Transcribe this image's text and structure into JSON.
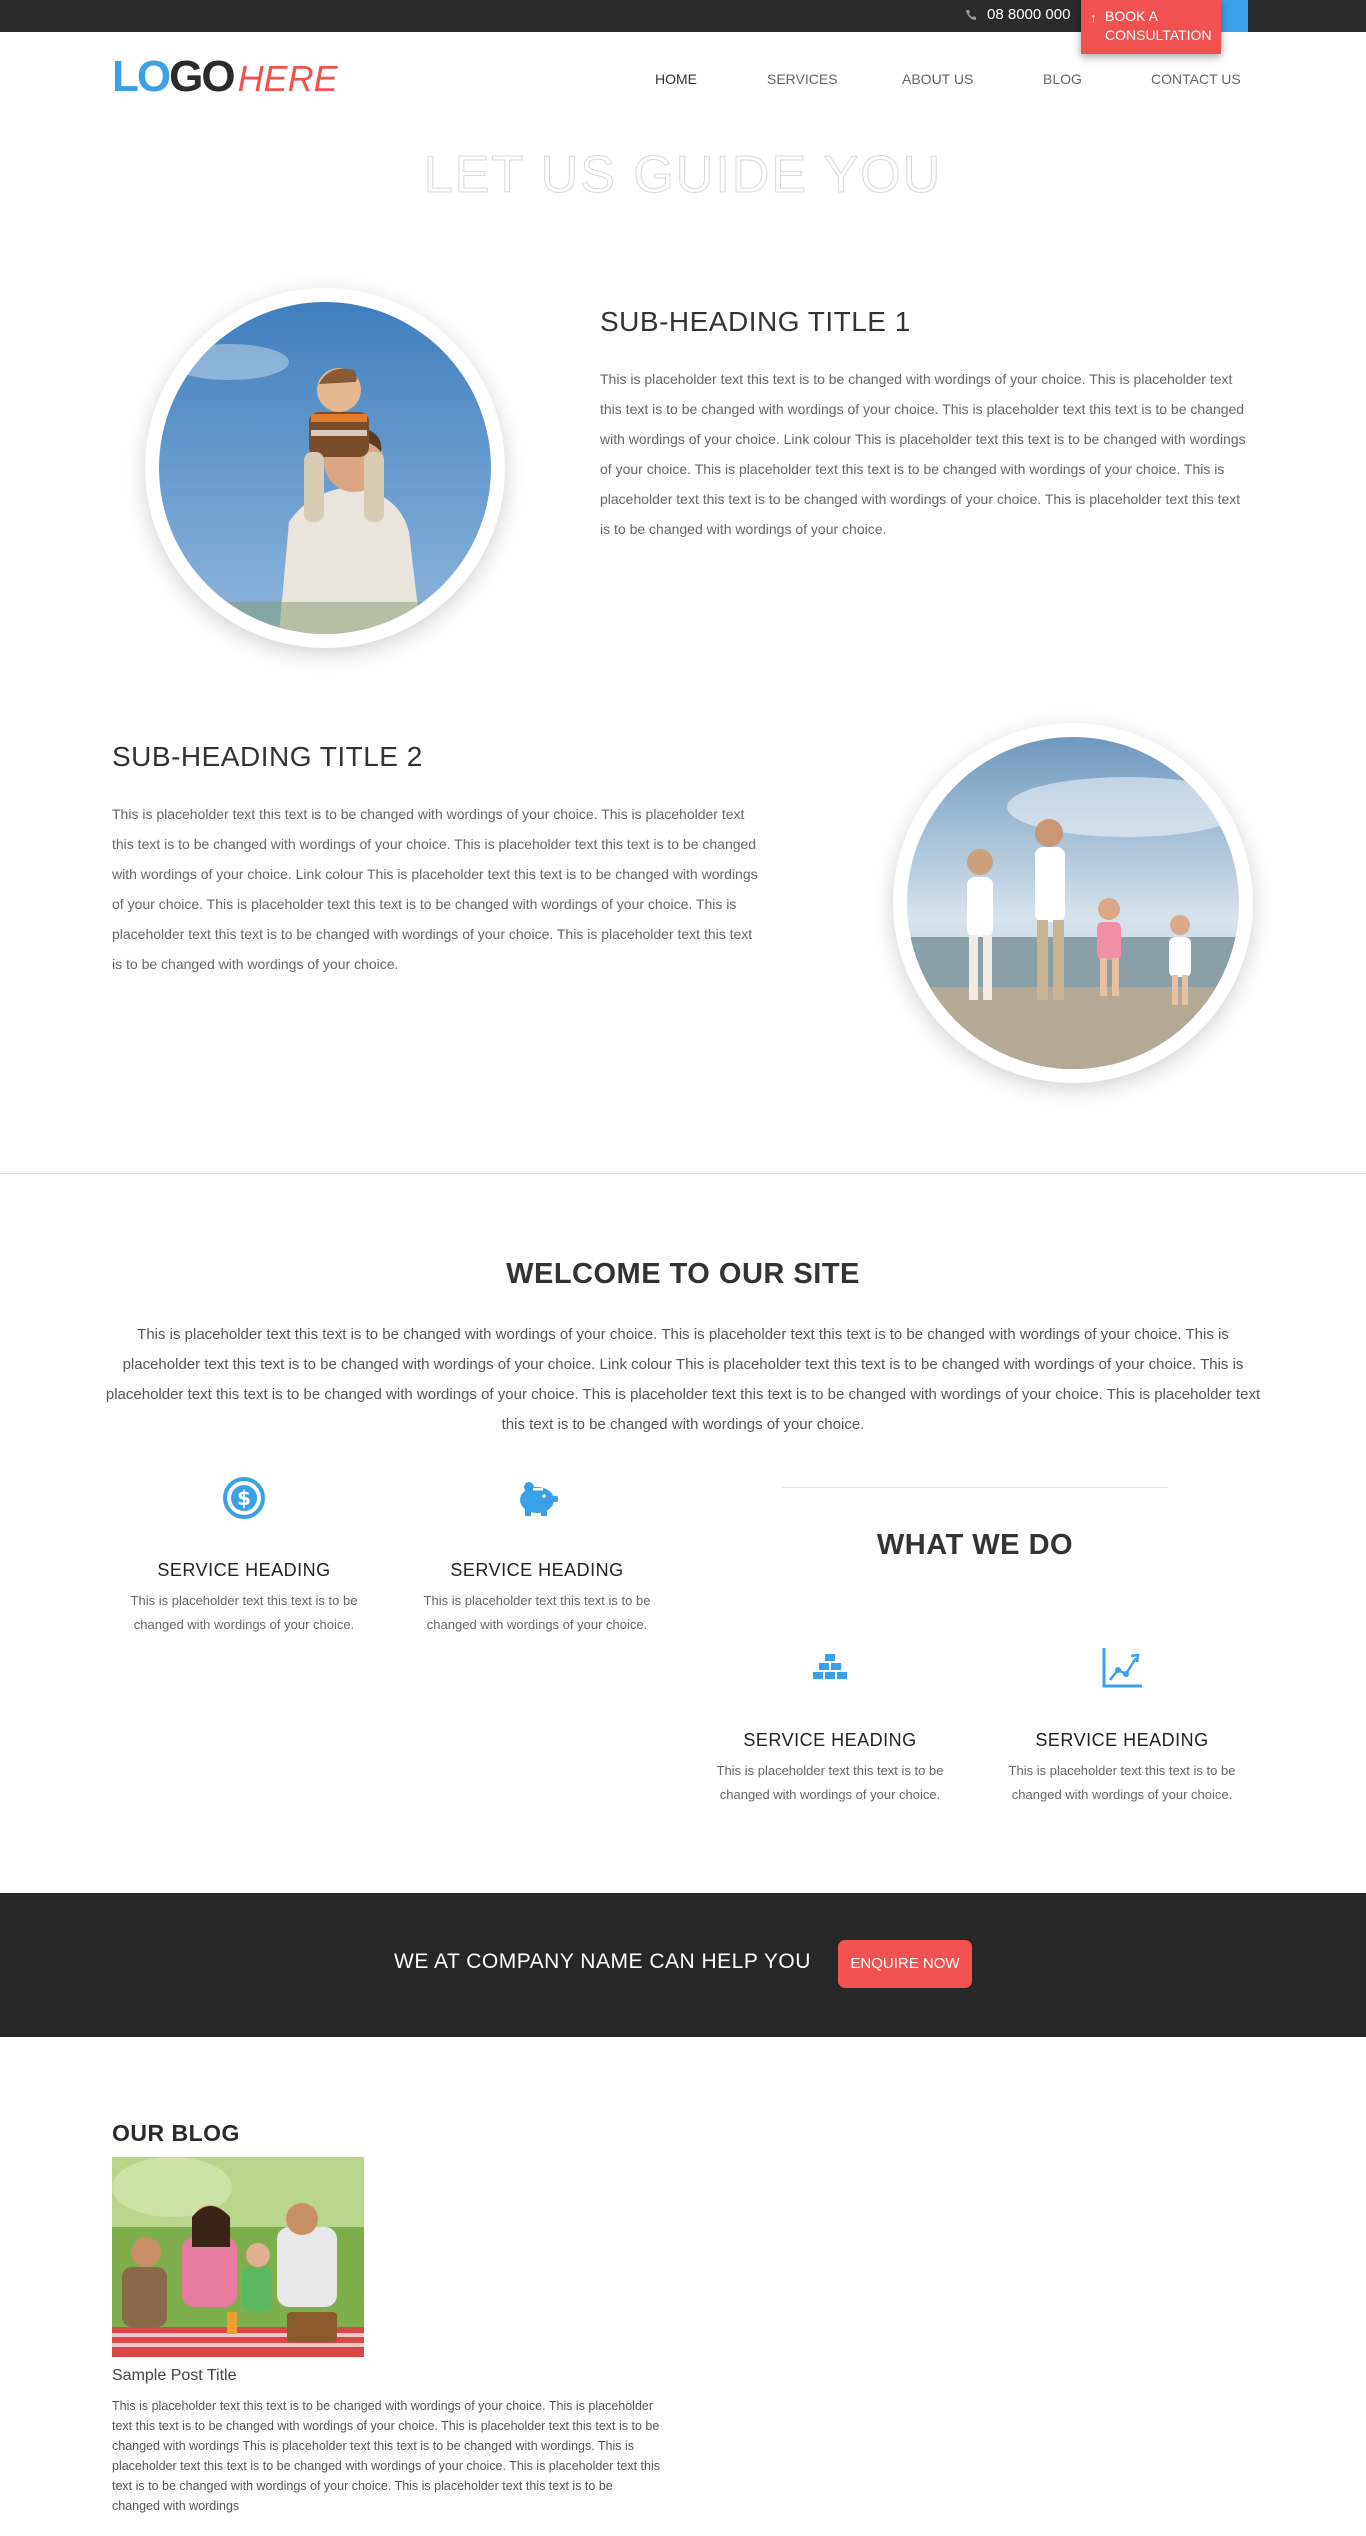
{
  "topbar": {
    "phone": "08 8000 000",
    "book_button": {
      "line1": "BOOK A",
      "line2": "CONSULTATION"
    }
  },
  "header": {
    "logo": {
      "part1": "LO",
      "part2": "GO",
      "part3": "HERE"
    },
    "nav": [
      "HOME",
      "SERVICES",
      "ABOUT US",
      "BLOG",
      "CONTACT US"
    ]
  },
  "hero": {
    "title": "LET US GUIDE YOU"
  },
  "section1": {
    "heading": "SUB-HEADING TITLE 1",
    "text": "This is placeholder text this text is to be changed with wordings of your choice. This is placeholder text this text is to be changed with wordings of your choice. This is placeholder text this text is to be changed with wordings of your choice. Link colour This is placeholder text this text is to be changed with wordings of your choice. This is placeholder text this text is to be changed with wordings of your choice. This is placeholder text this text is to be changed with wordings of your choice. This is placeholder text this text is to be changed with wordings of your choice."
  },
  "section2": {
    "heading": "SUB-HEADING TITLE 2",
    "text": "This is placeholder text this text is to be changed with wordings of your choice. This is placeholder text this text is to be changed with wordings of your choice. This is placeholder text this text is to be changed with wordings of your choice. Link colour This is placeholder text this text is to be changed with wordings of your choice. This is placeholder text this text is to be changed with wordings of your choice. This is placeholder text this text is to be changed with wordings of your choice. This is placeholder text this text is to be changed with wordings of your choice."
  },
  "welcome": {
    "title": "WELCOME TO OUR SITE",
    "text": "This is placeholder text this text is to be changed with wordings of your choice. This is placeholder text this text is to be changed with wordings of your choice. This is placeholder text this text is to be changed with wordings of your choice. Link colour This is placeholder text this text is to be changed with wordings of your choice. This is placeholder text this text is to be changed with wordings of your choice. This is placeholder text this text is to be changed with wordings of your choice. This is placeholder text this text is to be changed with wordings of your choice."
  },
  "services": [
    {
      "icon": "dollar-icon",
      "heading": "SERVICE HEADING",
      "text": "This is placeholder text this text is to be changed with wordings of your choice."
    },
    {
      "icon": "piggy-bank-icon",
      "heading": "SERVICE HEADING",
      "text": "This is placeholder text this text is to be changed with wordings of your choice."
    },
    {
      "icon": "gold-bars-icon",
      "heading": "SERVICE HEADING",
      "text": "This is placeholder text this text is to be changed with wordings of your choice."
    },
    {
      "icon": "chart-growth-icon",
      "heading": "SERVICE HEADING",
      "text": "This is placeholder text this text is to be changed with wordings of your choice."
    }
  ],
  "what_we_do": {
    "title": "WHAT WE DO"
  },
  "cta": {
    "text": "WE AT COMPANY NAME CAN HELP YOU",
    "button": "ENQUIRE NOW"
  },
  "blog": {
    "title": "OUR BLOG",
    "post_title": "Sample Post Title",
    "post_text": "This is placeholder text this text is to be changed with wordings of your choice. This is placeholder text this text is to be changed with wordings of your choice. This is placeholder text this text is to be changed with wordings This is placeholder text this text is to be changed with wordings. This is placeholder text this text is to be changed with wordings of your choice. This is placeholder text this text is to be changed with wordings of your choice. This is placeholder text this text is to be changed with wordings"
  },
  "colors": {
    "accent_blue": "#3aa0e8",
    "accent_red": "#f2524f",
    "dark": "#272727"
  }
}
